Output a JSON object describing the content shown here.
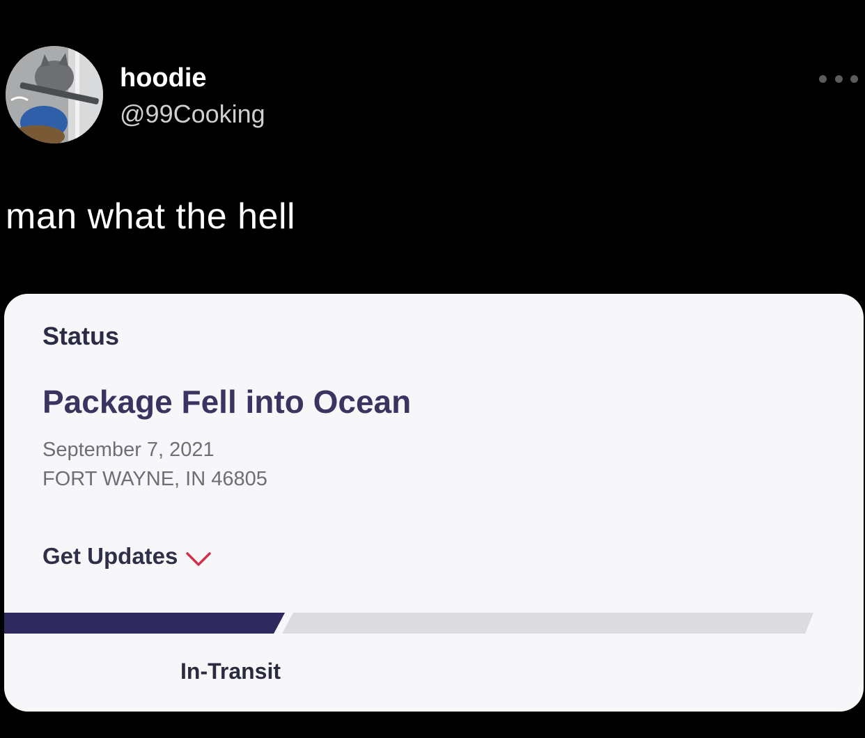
{
  "tweet": {
    "author": {
      "display_name": "hoodie",
      "handle": "@99Cooking",
      "avatar_icon": "cat-with-rifle-avatar-icon"
    },
    "more_icon": "more-options-icon",
    "text": "man what the hell"
  },
  "tracking_card": {
    "status_label": "Status",
    "status_value": "Package Fell into Ocean",
    "date": "September 7, 2021",
    "location": "FORT WAYNE, IN 46805",
    "updates_label": "Get Updates",
    "updates_icon": "chevron-down-icon",
    "progress": {
      "fraction": 0.34,
      "label": "In-Transit"
    }
  },
  "colors": {
    "background": "#000000",
    "card_background": "#f7f6f9",
    "progress_fill": "#2e2a5e",
    "progress_track": "#dcdcde",
    "status_value_text": "#3a3560",
    "chevron": "#d22f4b"
  }
}
